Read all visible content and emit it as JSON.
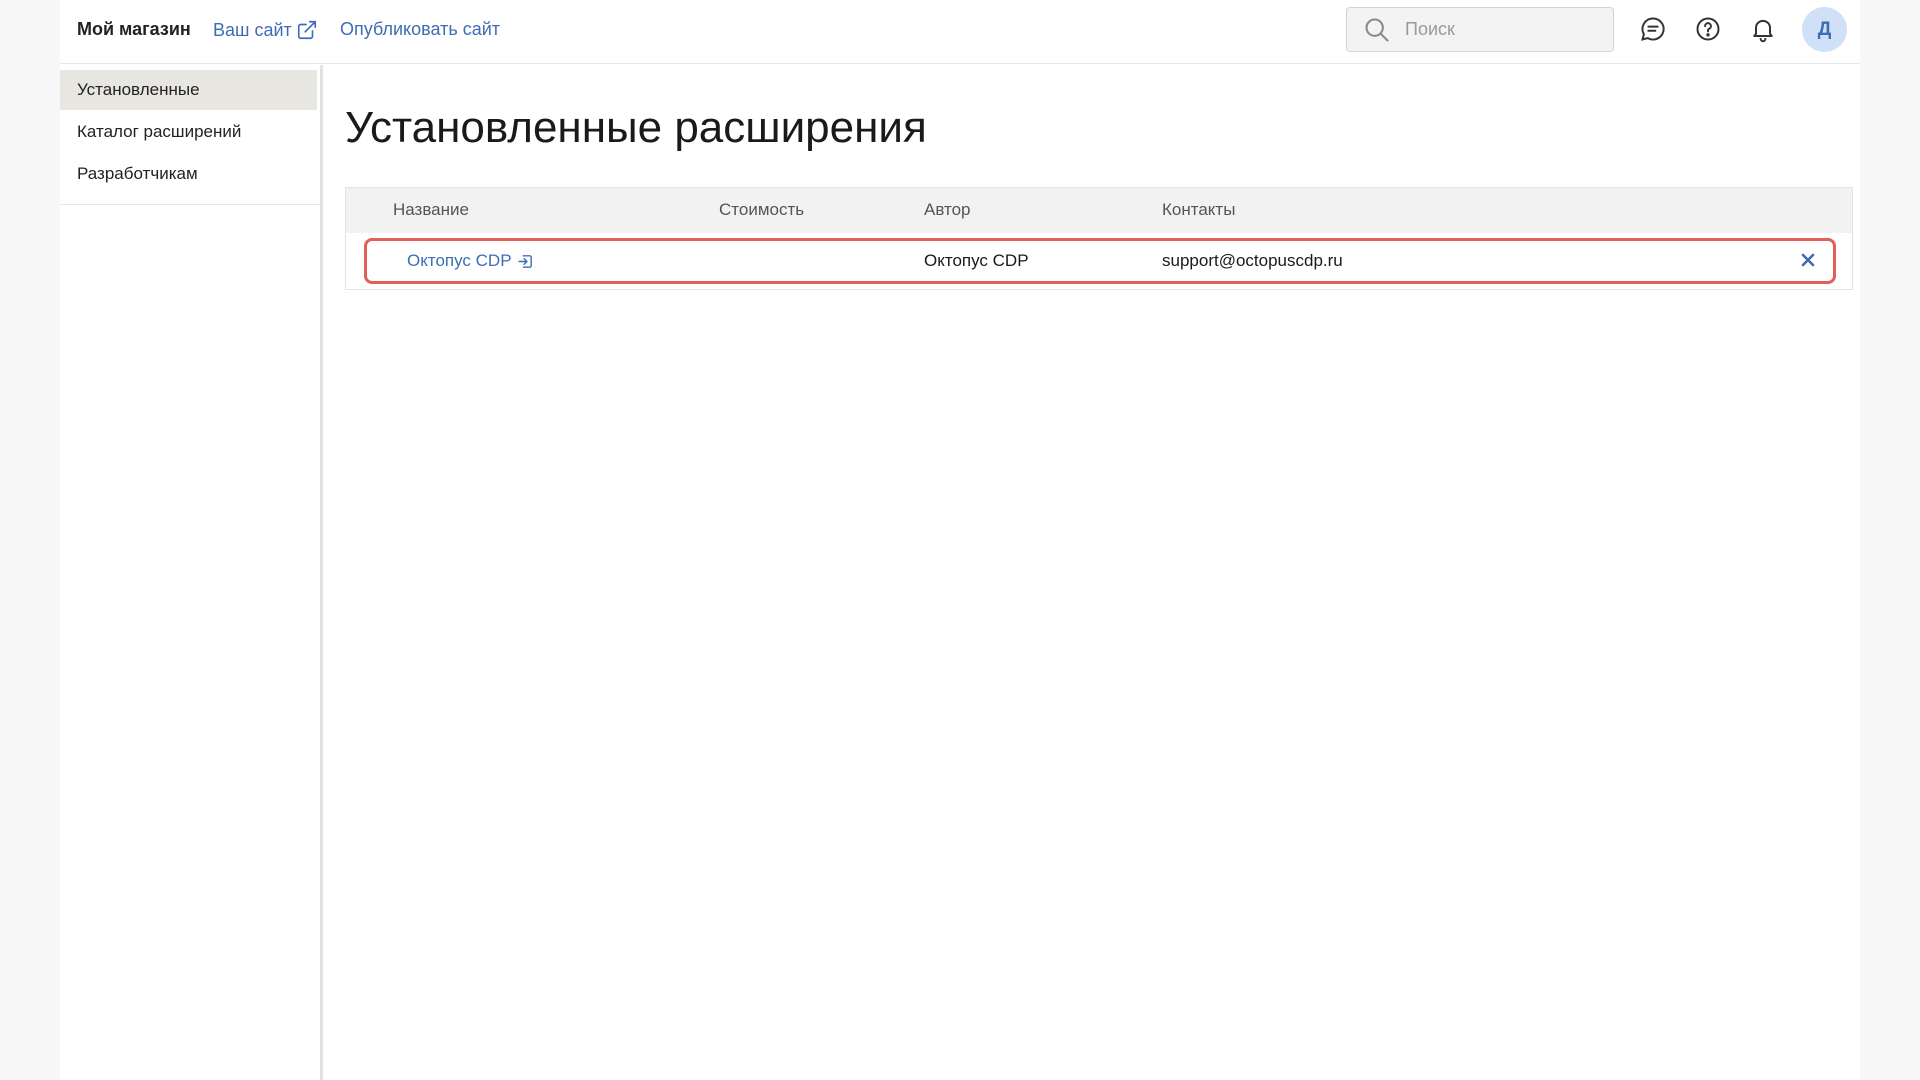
{
  "header": {
    "brand": "Мой магазин",
    "your_site": "Ваш сайт",
    "publish_site": "Опубликовать сайт",
    "search_placeholder": "Поиск",
    "avatar_letter": "Д",
    "icons": [
      "search-icon",
      "chat-icon",
      "help-icon",
      "bell-icon",
      "external-link-icon"
    ]
  },
  "sidebar": {
    "items": [
      {
        "label": "Установленные",
        "active": true
      },
      {
        "label": "Каталог расширений",
        "active": false
      },
      {
        "label": "Разработчикам",
        "active": false
      }
    ]
  },
  "main": {
    "title": "Установленные расширения",
    "table": {
      "columns": [
        "Название",
        "Стоимость",
        "Автор",
        "Контакты"
      ],
      "rows": [
        {
          "name": "Октопус CDP",
          "price": "",
          "author": "Октопус CDP",
          "contacts": "support@octopuscdp.ru",
          "highlighted": true
        }
      ]
    }
  },
  "colors": {
    "accent": "#3d6db5",
    "highlight": "#e2605a",
    "sidebar_active": "#e8e6e1",
    "avatar_bg": "#cfe0f7"
  }
}
